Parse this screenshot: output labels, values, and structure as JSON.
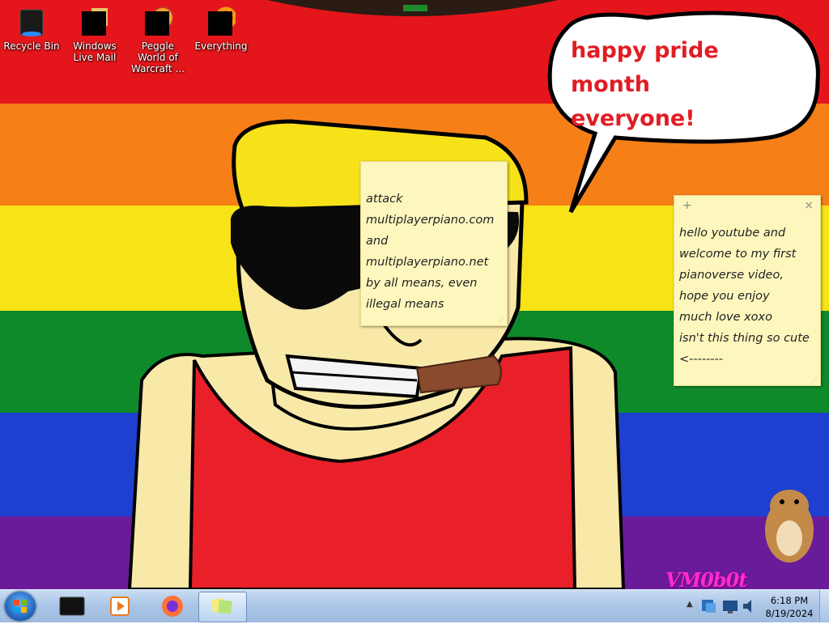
{
  "desktop": {
    "icons": [
      {
        "label": "Recycle Bin",
        "icon": "recycle-bin-icon"
      },
      {
        "label": "Windows Live Mail",
        "icon": "windows-live-mail-icon"
      },
      {
        "label": "Peggle World of Warcraft ...",
        "icon": "peggle-icon"
      },
      {
        "label": "Everything",
        "icon": "everything-search-icon"
      }
    ],
    "speech_bubble": {
      "line1": "happy pride month",
      "line2": "everyone!"
    },
    "watermark": "VM0b0t"
  },
  "sticky_notes": [
    {
      "text": "attack\nmultiplayerpiano.com\nand\nmultiplayerpiano.net\nby all means, even\nillegal means"
    },
    {
      "add_label": "+",
      "close_label": "×",
      "text": "hello youtube and\nwelcome to my first\npianoverse video,\nhope you enjoy\nmuch love xoxo\nisn't this thing so cute\n<--------"
    }
  ],
  "taskbar": {
    "start_icon": "windows-start-orb-icon",
    "pinned": [
      {
        "name": "command-prompt",
        "icon": "terminal-icon"
      },
      {
        "name": "windows-media-player",
        "icon": "media-player-icon"
      },
      {
        "name": "firefox",
        "icon": "firefox-icon"
      },
      {
        "name": "sticky-notes",
        "icon": "sticky-notes-icon",
        "active": true
      }
    ],
    "tray": {
      "time": "6:18 PM",
      "date": "8/19/2024"
    }
  },
  "colors": {
    "rainbow": [
      "#e5161b",
      "#f77f18",
      "#f8e416",
      "#0e8a2b",
      "#1e40d0",
      "#6a1b9a"
    ],
    "bubble_text": "#e11d24",
    "note_bg": "#fdf7bd",
    "watermark": "#ff2ad4"
  }
}
